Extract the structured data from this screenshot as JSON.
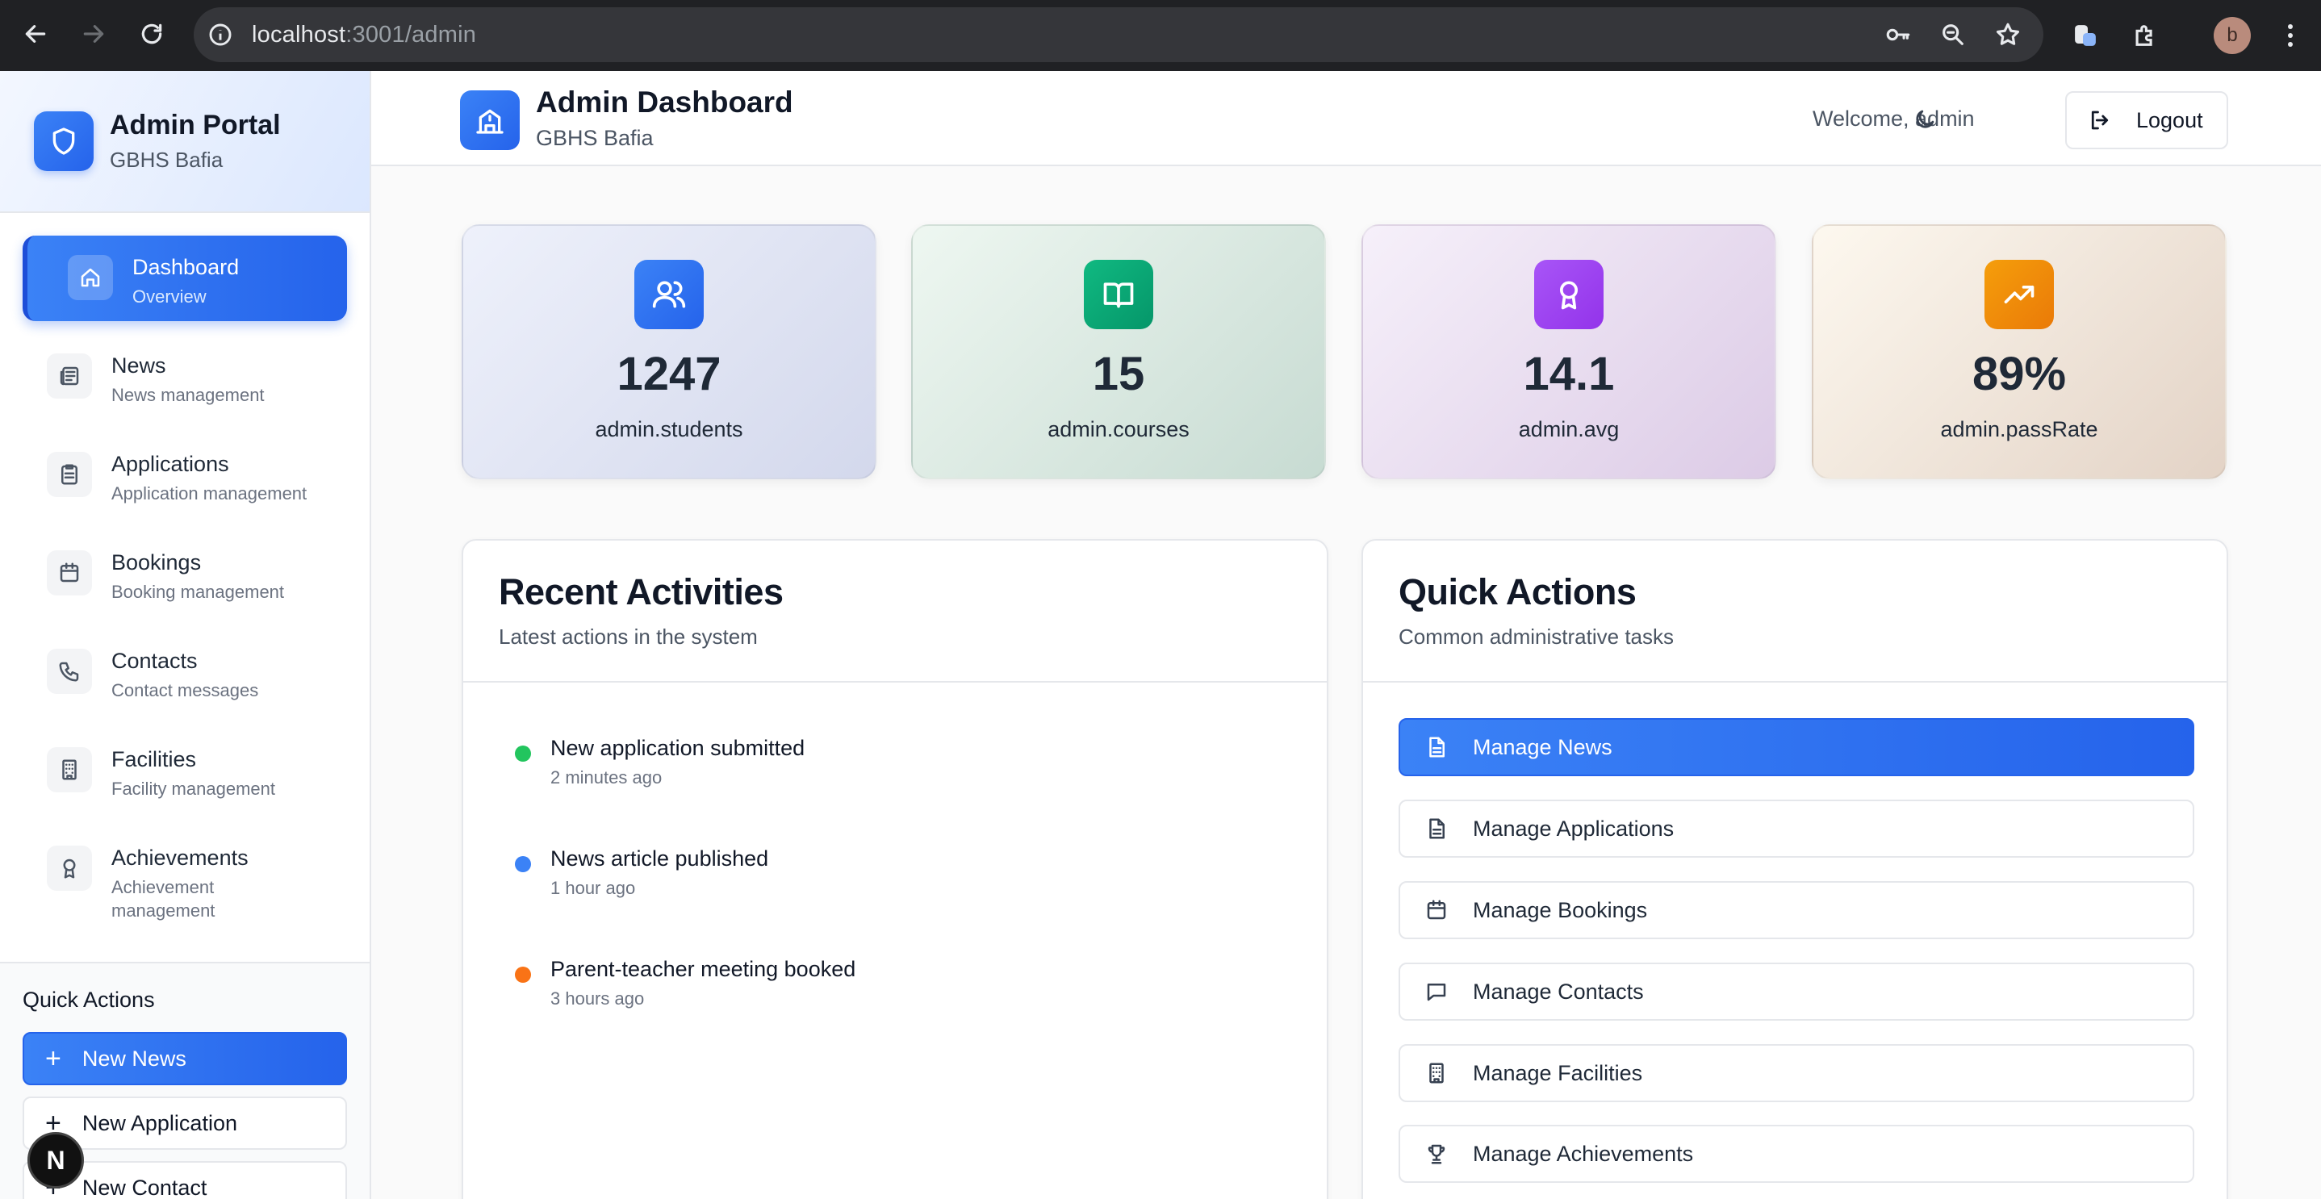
{
  "browser": {
    "url_host": "localhost",
    "url_path": ":3001/admin",
    "profile_initial": "b"
  },
  "sidebar": {
    "title": "Admin Portal",
    "subtitle": "GBHS Bafia",
    "items": [
      {
        "label": "Dashboard",
        "sub": "Overview",
        "icon": "home-icon",
        "active": true
      },
      {
        "label": "News",
        "sub": "News management",
        "icon": "newspaper-icon"
      },
      {
        "label": "Applications",
        "sub": "Application management",
        "icon": "clipboard-icon"
      },
      {
        "label": "Bookings",
        "sub": "Booking management",
        "icon": "calendar-icon"
      },
      {
        "label": "Contacts",
        "sub": "Contact messages",
        "icon": "phone-icon"
      },
      {
        "label": "Facilities",
        "sub": "Facility management",
        "icon": "building-icon"
      },
      {
        "label": "Achievements",
        "sub": "Achievement management",
        "icon": "award-icon"
      }
    ],
    "quick_actions": {
      "title": "Quick Actions",
      "buttons": [
        "New News",
        "New Application",
        "New Contact"
      ]
    },
    "badge": "N"
  },
  "header": {
    "title": "Admin Dashboard",
    "subtitle": "GBHS Bafia",
    "welcome": "Welcome, admin",
    "logout": "Logout"
  },
  "stats": [
    {
      "value": "1247",
      "label": "admin.students",
      "icon": "users-icon"
    },
    {
      "value": "15",
      "label": "admin.courses",
      "icon": "book-open-icon"
    },
    {
      "value": "14.1",
      "label": "admin.avg",
      "icon": "award-icon"
    },
    {
      "value": "89%",
      "label": "admin.passRate",
      "icon": "trending-up-icon"
    }
  ],
  "recent": {
    "title": "Recent Activities",
    "subtitle": "Latest actions in the system",
    "items": [
      {
        "text": "New application submitted",
        "time": "2 minutes ago",
        "color": "#22c55e"
      },
      {
        "text": "News article published",
        "time": "1 hour ago",
        "color": "#3b82f6"
      },
      {
        "text": "Parent-teacher meeting booked",
        "time": "3 hours ago",
        "color": "#f97316"
      }
    ]
  },
  "quick_actions": {
    "title": "Quick Actions",
    "subtitle": "Common administrative tasks",
    "buttons": [
      {
        "label": "Manage News",
        "icon": "file-text-icon"
      },
      {
        "label": "Manage Applications",
        "icon": "file-text-icon"
      },
      {
        "label": "Manage Bookings",
        "icon": "calendar-icon"
      },
      {
        "label": "Manage Contacts",
        "icon": "message-square-icon"
      },
      {
        "label": "Manage Facilities",
        "icon": "building-icon"
      },
      {
        "label": "Manage Achievements",
        "icon": "trophy-icon"
      }
    ]
  },
  "colors": {
    "accent": "#2563eb",
    "students": "#3b82f6",
    "courses": "#10b981",
    "avg": "#a855f7",
    "passRate": "#f59e0b"
  }
}
